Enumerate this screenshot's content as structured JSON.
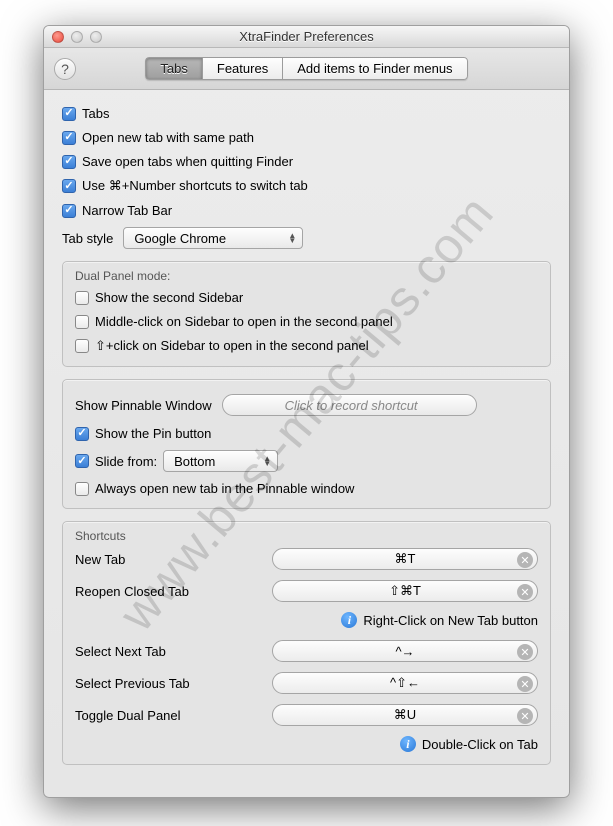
{
  "window": {
    "title": "XtraFinder Preferences"
  },
  "toolbar": {
    "tabs": [
      "Tabs",
      "Features",
      "Add items to Finder menus"
    ],
    "active_index": 0,
    "help_glyph": "?"
  },
  "main_checks": {
    "tabs": "Tabs",
    "open_new_tab_same_path": "Open new tab with same path",
    "save_open_tabs": "Save open tabs when quitting Finder",
    "cmd_number_switch": "Use ⌘+Number shortcuts to switch tab",
    "narrow_tab_bar": "Narrow Tab Bar"
  },
  "tab_style": {
    "label": "Tab style",
    "value": "Google Chrome"
  },
  "dual_panel": {
    "title": "Dual Panel mode:",
    "show_second_sidebar": "Show the second Sidebar",
    "middle_click_sidebar": "Middle-click on Sidebar to open in the second panel",
    "shift_click_sidebar": "⇧+click on Sidebar to open in the second panel"
  },
  "pinnable": {
    "show_window_label": "Show Pinnable Window",
    "record_placeholder": "Click to record shortcut",
    "show_pin_button": "Show the Pin button",
    "slide_from_label": "Slide from:",
    "slide_from_value": "Bottom",
    "always_open_new_tab": "Always open new tab in the Pinnable window"
  },
  "shortcuts": {
    "title": "Shortcuts",
    "new_tab": {
      "label": "New Tab",
      "value": "⌘T"
    },
    "reopen_closed": {
      "label": "Reopen Closed Tab",
      "value": "⇧⌘T"
    },
    "hint_right_click": "Right-Click on New Tab button",
    "select_next": {
      "label": "Select Next Tab",
      "value": "^→"
    },
    "select_prev": {
      "label": "Select Previous Tab",
      "value": "^⇧←"
    },
    "toggle_dual": {
      "label": "Toggle Dual Panel",
      "value": "⌘U"
    },
    "hint_double_click": "Double-Click on Tab"
  },
  "watermark": "www.best-mac-tips.com"
}
